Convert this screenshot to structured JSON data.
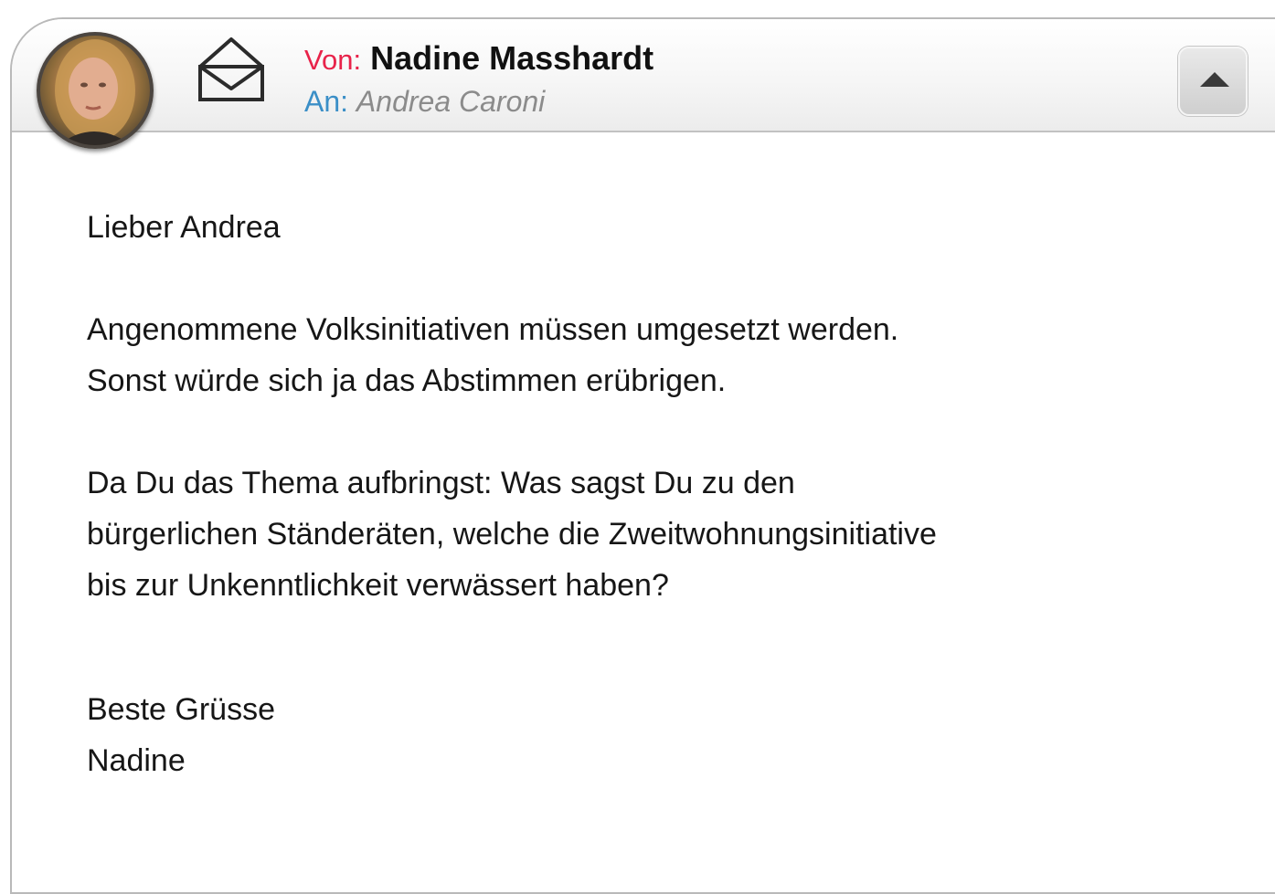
{
  "header": {
    "from_label": "Von:",
    "from_name": "Nadine Masshardt",
    "to_label": "An:",
    "to_name": "Andrea Caroni",
    "envelope_icon": "open-envelope-icon",
    "collapse_icon": "caret-up-icon"
  },
  "message": {
    "greeting": "Lieber Andrea",
    "paragraph1": [
      "Angenommene Volksinitiativen müssen umgesetzt werden.",
      "Sonst würde sich ja das Abstimmen erübrigen."
    ],
    "paragraph2": [
      "Da Du das Thema aufbringst: Was sagst Du zu den",
      "bürgerlichen Ständeräten, welche die Zweitwohnungsinitiative",
      "bis zur Unkenntlichkeit verwässert haben?"
    ],
    "closing": "Beste Grüsse",
    "signature": "Nadine"
  },
  "colors": {
    "from_label": "#e8234a",
    "to_label": "#3b8fc7",
    "to_name": "#8b8b8b"
  }
}
